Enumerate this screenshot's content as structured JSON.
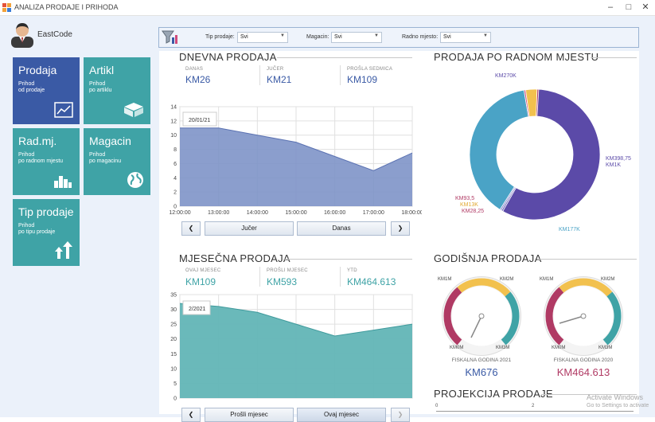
{
  "window": {
    "title": "ANALIZA PRODAJE I PRIHODA"
  },
  "user": {
    "name": "EastCode"
  },
  "tiles": [
    {
      "title": "Prodaja",
      "line1": "Prihod",
      "line2": "od prodaje",
      "color": "#3a5aa5",
      "icon": "chart-line-icon"
    },
    {
      "title": "Artikl",
      "line1": "Prihod",
      "line2": "po artiklu",
      "color": "#3fa3a6",
      "icon": "box-icon"
    },
    {
      "title": "Rad.mj.",
      "line1": "Prihod",
      "line2": "po radnom mjestu",
      "color": "#3fa3a6",
      "icon": "bar-chart-icon"
    },
    {
      "title": "Magacin",
      "line1": "Prihod",
      "line2": "po magacinu",
      "color": "#3fa3a6",
      "icon": "globe-icon"
    },
    {
      "title": "Tip prodaje",
      "line1": "Prihod",
      "line2": "po tipu prodaje",
      "color": "#3fa3a6",
      "icon": "arrows-up-icon"
    }
  ],
  "filters": {
    "tip_prodaje_label": "Tip prodaje:",
    "tip_prodaje_value": "Svi",
    "magacin_label": "Magacin:",
    "magacin_value": "Svi",
    "radno_mjesto_label": "Radno mjesto:",
    "radno_mjesto_value": "Svi"
  },
  "dnevna": {
    "title": "DNEVNA PRODAJA",
    "kpis": [
      {
        "label": "DANAS",
        "value": "KM26"
      },
      {
        "label": "JUČER",
        "value": "KM21"
      },
      {
        "label": "PROŠLA SEDMICA",
        "value": "KM109"
      }
    ],
    "tooltip": "20/01/21",
    "prev_label": "Jučer",
    "next_label": "Danas"
  },
  "mjesecna": {
    "title": "MJESEČNA PRODAJA",
    "kpis": [
      {
        "label": "OVAJ MJESEC",
        "value": "KM109"
      },
      {
        "label": "PROŠLI MJESEC",
        "value": "KM593"
      },
      {
        "label": "YTD",
        "value": "KM464.613"
      }
    ],
    "tooltip": "2/2021",
    "prev_label": "Prošli mjesec",
    "next_label": "Ovaj mjesec"
  },
  "radno_mjesto": {
    "title": "PRODAJA PO RADNOM MJESTU",
    "labels": {
      "a": "KM270K",
      "b": "KM398,75",
      "c": "KM1K",
      "d": "KM177K",
      "e": "KM93,5",
      "f": "KM13K",
      "g": "KM28,25"
    }
  },
  "godisnja": {
    "title": "GODIŠNJA PRODAJA",
    "g1": {
      "caption": "FISKALNA GODINA 2021",
      "value": "KM676",
      "color": "#3a5aa5"
    },
    "g2": {
      "caption": "FISKALNA GODINA 2020",
      "value": "KM464.613",
      "color": "#b03a64"
    },
    "ticks": {
      "t0": "KM0M",
      "t1": "KM1M",
      "t2": "KM2M",
      "t3": "KM3M"
    }
  },
  "projekcija": {
    "title": "PROJEKCIJA PRODAJE",
    "tick0": "0",
    "tick2": "2"
  },
  "watermark": {
    "line1": "Activate Windows",
    "line2": "Go to Settings to activate"
  },
  "chart_data": [
    {
      "type": "area",
      "title": "DNEVNA PRODAJA",
      "x": [
        "12:00:00",
        "13:00:00",
        "14:00:00",
        "15:00:00",
        "16:00:00",
        "17:00:00",
        "18:00:00"
      ],
      "values": [
        11,
        11,
        10,
        9,
        7,
        5,
        7.5
      ],
      "yticks": [
        "0",
        "2",
        "4",
        "6",
        "8",
        "10",
        "12",
        "14"
      ],
      "ylim": [
        0,
        14
      ],
      "grid": true
    },
    {
      "type": "area",
      "title": "MJESEČNA PRODAJA",
      "values": [
        32,
        31,
        29,
        25,
        21,
        23,
        25
      ],
      "yticks": [
        "0",
        "5",
        "10",
        "15",
        "20",
        "25",
        "30",
        "35"
      ],
      "ylim": [
        0,
        35
      ],
      "grid": true
    },
    {
      "type": "pie",
      "title": "PRODAJA PO RADNOM MJESTU",
      "labels": [
        "KM270K",
        "KM398,75",
        "KM1K",
        "KM177K",
        "KM93,5",
        "KM13K",
        "KM28,25"
      ],
      "values": [
        270000,
        398.75,
        1000,
        177000,
        93.5,
        13000,
        28.25
      ],
      "colors": [
        "#5b4aa8",
        "#8a8ad0",
        "#6a60b8",
        "#4aa3c6",
        "#d04a7a",
        "#f2c14e",
        "#b03a64"
      ]
    }
  ]
}
